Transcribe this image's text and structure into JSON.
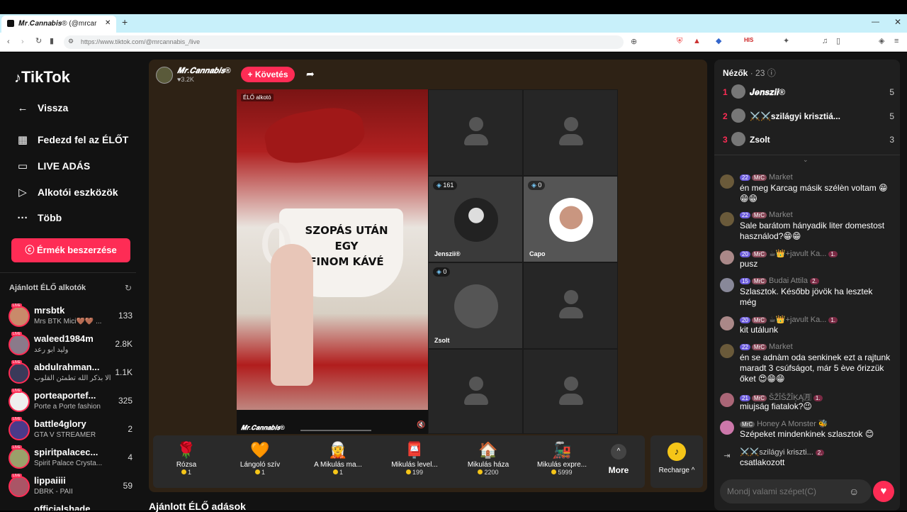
{
  "browser": {
    "tab_title": "𝑴𝒓.𝑪𝒂𝒏𝒏𝒂𝒃𝒊𝒔® (@mrcar",
    "tab_close": "✕",
    "new_tab": "+",
    "url": "https://www.tiktok.com/@mrcannabis_/live"
  },
  "sidebar": {
    "logo": "TikTok",
    "nav": [
      {
        "label": "Vissza",
        "icon": "back-arrow-icon"
      },
      {
        "label": "Fedezd fel az ÉLŐT",
        "icon": "calendar-live-icon"
      },
      {
        "label": "LIVE ADÁS",
        "icon": "video-camera-icon"
      },
      {
        "label": "Alkotói eszközök",
        "icon": "creator-tools-icon"
      },
      {
        "label": "Több",
        "icon": "more-dots-icon"
      }
    ],
    "coins_button": "Érmék beszerzése",
    "recommended_title": "Ajánlott ÉLŐ alkotók",
    "live_tag": "LIVE",
    "creators": [
      {
        "name": "mrsbtk",
        "sub": "Mrs BTK Mici🤎🤎 ...",
        "count": "133"
      },
      {
        "name": "waleed1984m",
        "sub": "وليد ابو رعد",
        "count": "2.8K"
      },
      {
        "name": "abdulrahman...",
        "sub": "ألا بذكر الله تطمئن القلوب ...",
        "count": "1.1K"
      },
      {
        "name": "porteaportef...",
        "sub": "Porte a Porte fashion",
        "count": "325"
      },
      {
        "name": "battle4glory",
        "sub": "GTA V STREAMER",
        "count": "2"
      },
      {
        "name": "spiritpalacec...",
        "sub": "Spirit Palace Crysta...",
        "count": "4"
      },
      {
        "name": "lippaiiii",
        "sub": "DBRK - PAII",
        "count": "59"
      },
      {
        "name": "officialshade",
        "sub": "",
        "count": ""
      }
    ]
  },
  "stage": {
    "host_name": "𝑴𝒓.𝑪𝒂𝒏𝒏𝒂𝒃𝒊𝒔®",
    "host_likes": "♥3.2K",
    "follow_button": "+ Követés",
    "video_label": "ÉLŐ alkotó",
    "mug_text_line1": "SZOPÁS UTÁN EGY",
    "mug_text_line2": "FINOM KÁVÉ",
    "video_footer_name": "𝑴𝒓.𝑪𝒂𝒏𝒏𝒂𝒃𝒊𝒔®",
    "guests": [
      {
        "name": "Jenszii®",
        "badge": "161"
      },
      {
        "name": "Capo",
        "badge": "0"
      },
      {
        "name": "Zsolt",
        "badge": "0"
      }
    ]
  },
  "gifts": [
    {
      "name": "Rózsa",
      "price": "1",
      "icon": "🌹"
    },
    {
      "name": "Lángoló szív",
      "price": "1",
      "icon": "🧡"
    },
    {
      "name": "A Mikulás ma...",
      "price": "1",
      "icon": "🧝"
    },
    {
      "name": "Mikulás level...",
      "price": "199",
      "icon": "📮"
    },
    {
      "name": "Mikulás háza",
      "price": "2200",
      "icon": "🏠"
    },
    {
      "name": "Mikulás expre...",
      "price": "5999",
      "icon": "🚂"
    }
  ],
  "gift_more": "More",
  "recharge": "Recharge ^",
  "section_title": "Ajánlott ÉLŐ adások",
  "viewers_panel": {
    "title": "Nézők",
    "count": "· 23",
    "list": [
      {
        "rank": "1",
        "name": "𝑱𝒆𝒏𝒔𝒛𝒊𝒊®",
        "score": "5"
      },
      {
        "rank": "2",
        "name": "⚔️⚔️szilágyi krisztiá...",
        "score": "5"
      },
      {
        "rank": "3",
        "name": "Zsolt",
        "score": "3"
      }
    ]
  },
  "chat": [
    {
      "level": "22",
      "tag": "MrC",
      "name": "Market",
      "extra": "",
      "text": "én meg Karcag másik szélèn voltam 😁😁😁"
    },
    {
      "level": "22",
      "tag": "MrC",
      "name": "Market",
      "extra": "",
      "text": "Sale barátom hányadik liter domestost használod?😁😁"
    },
    {
      "level": "20",
      "tag": "MrC",
      "name": "☕👑+javult Ka...",
      "extra": "1.",
      "text": "pusz"
    },
    {
      "level": "15",
      "tag": "MrC",
      "name": "Budai Attila",
      "extra": "2.",
      "text": "Szlasztok. Később jövök ha lesztek még"
    },
    {
      "level": "20",
      "tag": "MrC",
      "name": "☕👑+javult Ka...",
      "extra": "1.",
      "text": "kit utálunk"
    },
    {
      "level": "22",
      "tag": "MrC",
      "name": "Market",
      "extra": "",
      "text": "én se adnàm oda senkinek ezt a rajtunk maradt 3 csúfságot, már 5 ève őrizzük őket 😍😁😁"
    },
    {
      "level": "21",
      "tag": "MrC",
      "name": "ŠŽÎŠŽÎĶĄ🈷",
      "extra": "1.",
      "text": "miujság fiatalok?😉"
    },
    {
      "level": "",
      "tag": "MrC",
      "name": "Honey A Monster 🐝",
      "extra": "",
      "text": "Szépeket mindenkinek szlasztok 😊"
    },
    {
      "level": "",
      "tag": "",
      "name": "⚔️⚔️szilágyi kriszti...",
      "extra": "2.",
      "text": "csatlakozott"
    }
  ],
  "chat_input_placeholder": "Mondj valami szépet(C)"
}
